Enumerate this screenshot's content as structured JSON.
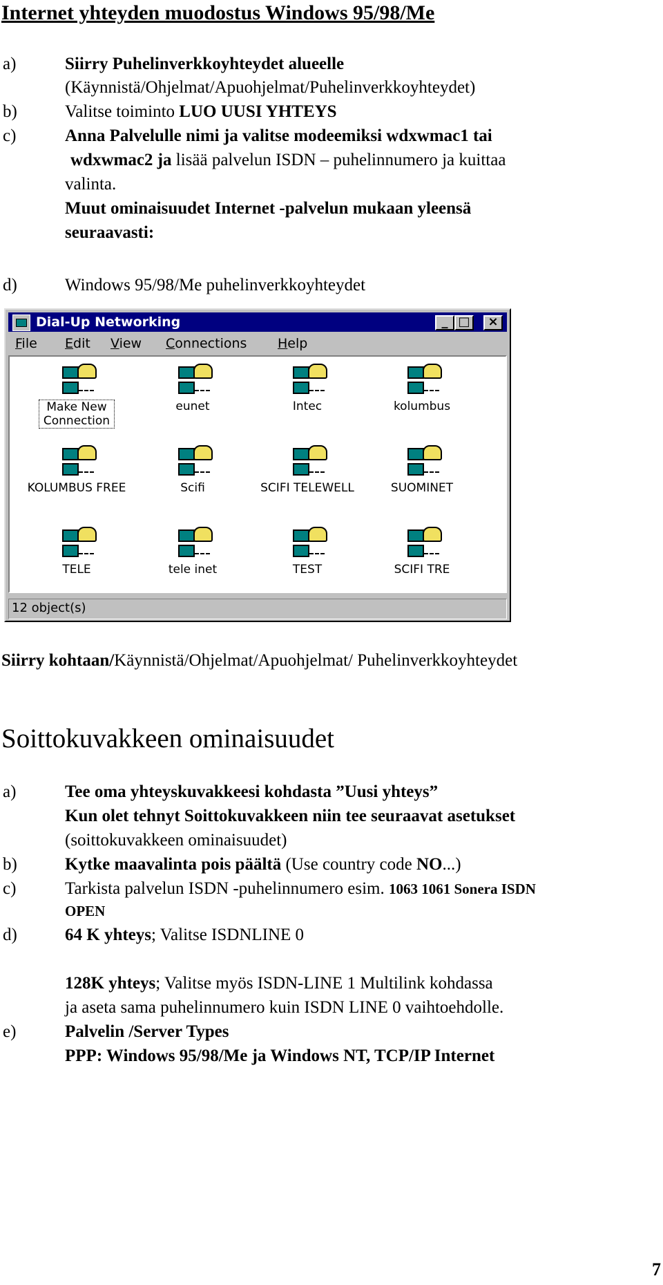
{
  "page_title": "Internet yhteyden muodostus Windows 95/98/Me",
  "steps1": [
    {
      "label": "a)",
      "lines": [
        "Siirry Puhelinverkkoyhteydet alueelle",
        "(Käynnistä/Ohjelmat/Apuohjelmat/Puhelinverkkoyhteydet)"
      ]
    },
    {
      "label": "b)",
      "pre": "Valitse toiminto ",
      "bold": "LUO UUSI YHTEYS"
    },
    {
      "label": "c)",
      "line1": "Anna Palvelulle nimi ja valitse modeemiksi wdxwmac1 tai",
      "line2_bold": "wdxwmac2 ja",
      "line2_rest": " lisää palvelun ISDN – puhelinnumero ja kuittaa",
      "line3": "valinta.",
      "line4": "Muut ominaisuudet Internet -palvelun mukaan yleensä",
      "line5": "seuraavasti:"
    },
    {
      "label": "d)",
      "text": "Windows 95/98/Me puhelinverkkoyhteydet"
    }
  ],
  "window": {
    "title": "Dial-Up Networking",
    "minimize": "_",
    "maximize": "□",
    "close": "×",
    "menus": [
      "File",
      "Edit",
      "View",
      "Connections",
      "Help"
    ],
    "icons": [
      "Make New Connection",
      "eunet",
      "Intec",
      "kolumbus",
      "KOLUMBUS FREE",
      "Scifi",
      "SCIFI TELEWELL",
      "SUOMINET",
      "TELE",
      "tele inet",
      "TEST",
      "SCIFI TRE"
    ],
    "status": "12 object(s)"
  },
  "nav_bold": "Siirry kohtaan/",
  "nav_rest": "Käynnistä/Ohjelmat/Apuohjelmat/ Puhelinverkkoyhteydet",
  "heading2": "Soittokuvakkeen ominaisuudet",
  "steps2": {
    "a_label": "a)",
    "a1": "Tee oma yhteyskuvakkeesi kohdasta ”Uusi yhteys”",
    "a2": "Kun olet tehnyt Soittokuvakkeen niin tee seuraavat asetukset",
    "a3": "(soittokuvakkeen ominaisuudet)",
    "b_label": "b)",
    "b_bold": "Kytke maavalinta pois päältä",
    "b_rest1": " (Use country code  ",
    "b_no": "NO",
    "b_rest2": "...)",
    "c_label": "c)",
    "c_pre": "Tarkista palvelun ISDN -puhelinnumero esim. ",
    "c_bold": "1063 1061 Sonera ISDN",
    "c_bold2": "OPEN",
    "d_label": "d)",
    "d_bold": "64 K yhteys",
    "d_rest": "; Valitse ISDNLINE 0",
    "d2_bold": "128K yhteys",
    "d2_rest": "; Valitse myös ISDN-LINE 1 Multilink kohdassa",
    "d3": "ja aseta sama puhelinnumero kuin ISDN LINE 0 vaihtoehdolle.",
    "e_label": "e)",
    "e1": "Palvelin /Server Types",
    "e2": "PPP: Windows 95/98/Me ja  Windows NT, TCP/IP Internet"
  },
  "page_number": "7"
}
